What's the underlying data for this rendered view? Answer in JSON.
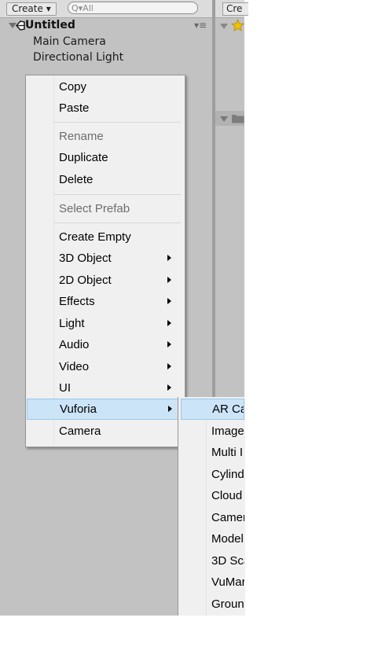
{
  "hierarchy": {
    "create_label": "Create ▾",
    "search_placeholder": "Q▾All",
    "scene_title": "Untitled",
    "scene_menu": "▾≡",
    "objects": [
      "Main Camera",
      "Directional Light"
    ]
  },
  "project_panel": {
    "create_label": "Cre"
  },
  "context_menu": {
    "items": [
      {
        "label": "Copy",
        "enabled": true,
        "submenu": false
      },
      {
        "label": "Paste",
        "enabled": true,
        "submenu": false
      },
      {
        "label": "Rename",
        "enabled": false,
        "submenu": false
      },
      {
        "label": "Duplicate",
        "enabled": true,
        "submenu": false
      },
      {
        "label": "Delete",
        "enabled": true,
        "submenu": false
      },
      {
        "label": "Select Prefab",
        "enabled": false,
        "submenu": false
      },
      {
        "label": "Create Empty",
        "enabled": true,
        "submenu": false
      },
      {
        "label": "3D Object",
        "enabled": true,
        "submenu": true
      },
      {
        "label": "2D Object",
        "enabled": true,
        "submenu": true
      },
      {
        "label": "Effects",
        "enabled": true,
        "submenu": true
      },
      {
        "label": "Light",
        "enabled": true,
        "submenu": true
      },
      {
        "label": "Audio",
        "enabled": true,
        "submenu": true
      },
      {
        "label": "Video",
        "enabled": true,
        "submenu": true
      },
      {
        "label": "UI",
        "enabled": true,
        "submenu": true
      },
      {
        "label": "Vuforia",
        "enabled": true,
        "submenu": true,
        "highlighted": true
      },
      {
        "label": "Camera",
        "enabled": true,
        "submenu": false
      }
    ]
  },
  "vuforia_submenu": {
    "items": [
      "AR Ca",
      "Image",
      "Multi I",
      "Cylind",
      "Cloud",
      "Camer",
      "Model",
      "3D Sca",
      "VuMar",
      "Groun"
    ]
  },
  "colors": {
    "highlight": "#cce4f7",
    "panel": "#c2c2c2",
    "menu": "#f0f0f0"
  }
}
